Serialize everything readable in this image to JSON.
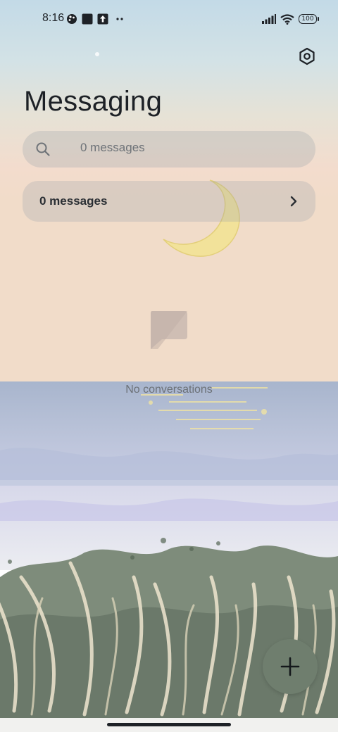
{
  "status_bar": {
    "time": "8:16",
    "battery": "100",
    "icons": [
      "paint-palette-icon",
      "square-notification-icon",
      "upload-icon",
      "more-dots-icon",
      "signal-icon",
      "wifi-icon",
      "battery-icon"
    ]
  },
  "header": {
    "title": "Messaging",
    "settings_icon": "settings-hexagon-icon"
  },
  "search": {
    "placeholder": "0 messages"
  },
  "summary": {
    "label": "0 messages"
  },
  "empty_state": {
    "text": "No conversations"
  },
  "fab": {
    "icon": "plus-icon"
  },
  "colors": {
    "sky_top": "#c5dbe6",
    "sky_bottom": "#f2dccd",
    "sea": "#a9b6cf",
    "grass": "#6f7e6e",
    "fab": "#6f7e6e",
    "moon": "#f2e29a"
  }
}
